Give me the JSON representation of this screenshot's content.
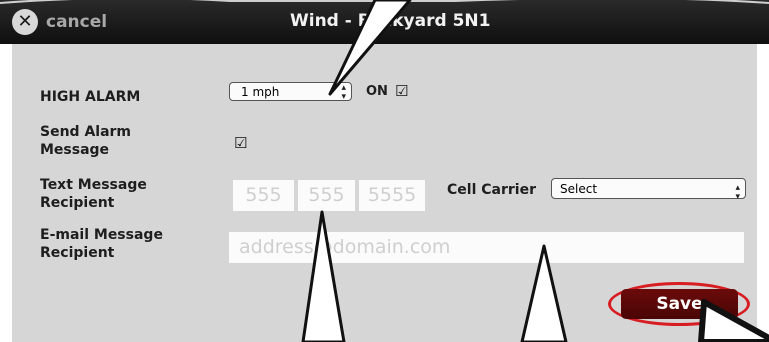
{
  "titlebar": {
    "cancel_label": "cancel",
    "title": "Wind - Backyard 5N1"
  },
  "form": {
    "high_alarm_label": "HIGH ALARM",
    "high_alarm_value": "1 mph",
    "high_alarm_on_label": "ON",
    "high_alarm_on_checked": true,
    "send_alarm_label": "Send Alarm\nMessage",
    "send_alarm_checked": true,
    "text_recipient_label": "Text Message\nRecipient",
    "phone_placeholders": [
      "555",
      "555",
      "5555"
    ],
    "cell_carrier_label": "Cell Carrier",
    "cell_carrier_value": "Select",
    "email_label": "E-mail Message\nRecipient",
    "email_placeholder": "address@domain.com",
    "save_label": "Save"
  },
  "icons": {
    "cancel": "close-icon",
    "checkbox": "checkmark-icon",
    "select_arrows": "up-down-arrows-icon",
    "cursor": "mouse-pointer-icon"
  },
  "colors": {
    "titlebar": "#1a1a1a",
    "panel": "#d6d6d6",
    "save": "#5a0808",
    "highlight": "#d81d22"
  }
}
